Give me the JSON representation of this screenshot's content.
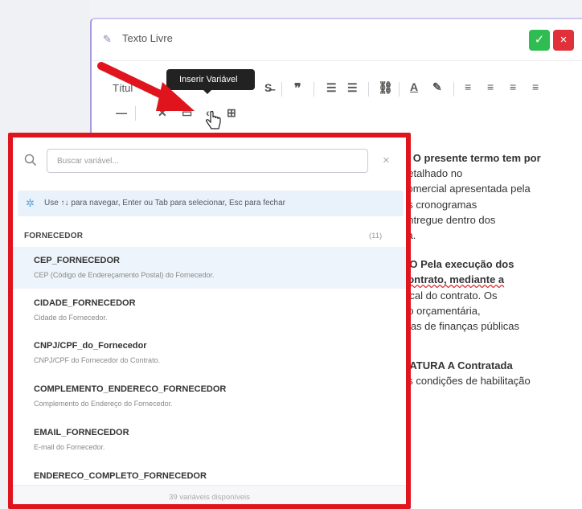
{
  "editor": {
    "title": "Texto Livre",
    "ok_symbol": "✓",
    "cancel_symbol": "×"
  },
  "toolbar": {
    "title_select": "Títul",
    "tooltip": "Inserir Variável"
  },
  "document_lines": [
    "O O presente termo tem por",
    "detalhado no",
    "comercial apresentada pela",
    "os cronogramas",
    "entregue dentro dos",
    "ca.",
    "",
    "ÃO Pela execução dos",
    "contrato, mediante a",
    "iscal do contrato. Os",
    "ão orçamentária,",
    "mas de finanças públicas",
    "",
    "",
    "NATURA A Contratada",
    "as condições de habilitação"
  ],
  "popup": {
    "search_placeholder": "Buscar variável...",
    "hint": "Use ↑↓ para navegar, Enter ou Tab para selecionar, Esc para fechar",
    "group_name": "FORNECEDOR",
    "group_count": "(11)",
    "items": [
      {
        "name": "CEP_FORNECEDOR",
        "desc": "CEP (Código de Endereçamento Postal) do Fornecedor."
      },
      {
        "name": "CIDADE_FORNECEDOR",
        "desc": "Cidade do Fornecedor."
      },
      {
        "name": "CNPJ/CPF_do_Fornecedor",
        "desc": "CNPJ/CPF do Fornecedor do Contrato."
      },
      {
        "name": "COMPLEMENTO_ENDERECO_FORNECEDOR",
        "desc": "Complemento do Endereço do Fornecedor."
      },
      {
        "name": "EMAIL_FORNECEDOR",
        "desc": "E-mail do Fornecedor."
      },
      {
        "name": "ENDERECO_COMPLETO_FORNECEDOR",
        "desc": ""
      }
    ],
    "footer": "39 variáveis disponíveis"
  },
  "colors": {
    "highlight_border": "#e0141c",
    "arrow": "#e0141c",
    "ok_button": "#2fbd52",
    "cancel_button": "#e0303a"
  }
}
